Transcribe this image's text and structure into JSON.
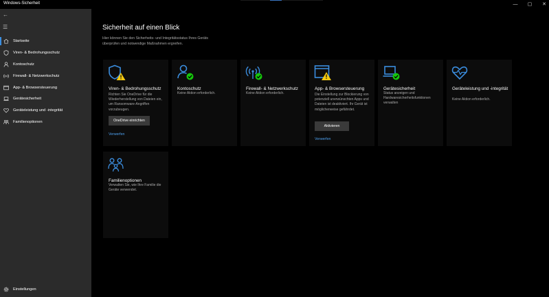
{
  "window": {
    "title": "Windows-Sicherheit",
    "minimize": "—",
    "maximize": "▢",
    "close": "✕"
  },
  "sidebar": {
    "back_icon": "←",
    "menu_icon": "☰",
    "items": [
      {
        "label": "Startseite",
        "icon": "home-icon"
      },
      {
        "label": "Viren- & Bedrohungsschutz",
        "icon": "shield-icon"
      },
      {
        "label": "Kontoschutz",
        "icon": "person-icon"
      },
      {
        "label": "Firewall- & Netzwerkschutz",
        "icon": "wifi-icon"
      },
      {
        "label": "App- & Browsersteuerung",
        "icon": "app-browser-icon"
      },
      {
        "label": "Gerätesicherheit",
        "icon": "laptop-icon"
      },
      {
        "label": "Geräteleistung und -integrität",
        "icon": "heart-icon"
      },
      {
        "label": "Familienoptionen",
        "icon": "family-icon"
      }
    ],
    "settings_label": "Einstellungen"
  },
  "main": {
    "title": "Sicherheit auf einen Blick",
    "subtitle": "Hier können Sie den Sicherheits- und Integritätsstatus Ihres Geräts überprüfen und notwendige Maßnahmen ergreifen.",
    "tiles": [
      {
        "title": "Viren- & Bedrohungsschutz",
        "desc": "Richten Sie OneDrive für die Wiederherstellung von Dateien ein, um Ransomware-Angriffen vorzubeugen.",
        "button": "OneDrive einrichten",
        "link": "Verwerfen",
        "status": "warning"
      },
      {
        "title": "Kontoschutz",
        "desc": "Keine Aktion erforderlich.",
        "status": "ok"
      },
      {
        "title": "Firewall- & Netzwerkschutz",
        "desc": "Keine Aktion erforderlich.",
        "status": "ok"
      },
      {
        "title": "App- & Browsersteuerung",
        "desc": "Die Einstellung zur Blockierung von potenziell unerwünschten Apps und Dateien ist deaktiviert. Ihr Gerät ist möglicherweise gefährdet.",
        "button": "Aktivieren",
        "link": "Verwerfen",
        "status": "warning"
      },
      {
        "title": "Gerätesicherheit",
        "desc": "Status anzeigen und Hardwaresicherheitsfunktionen verwalten",
        "status": "ok"
      },
      {
        "title": "Geräteleistung und -integrität",
        "desc": "Keine Aktion erforderlich."
      },
      {
        "title": "Familienoptionen",
        "desc": "Verwalten Sie, wie Ihre Familie die Geräte verwendet."
      }
    ]
  },
  "colors": {
    "accent_blue": "#3b8ee0",
    "ok_green": "#16c60c",
    "warning_yellow": "#f2c811",
    "link_blue": "#4ea0ee",
    "sidebar_bg": "#2b2b2b"
  }
}
